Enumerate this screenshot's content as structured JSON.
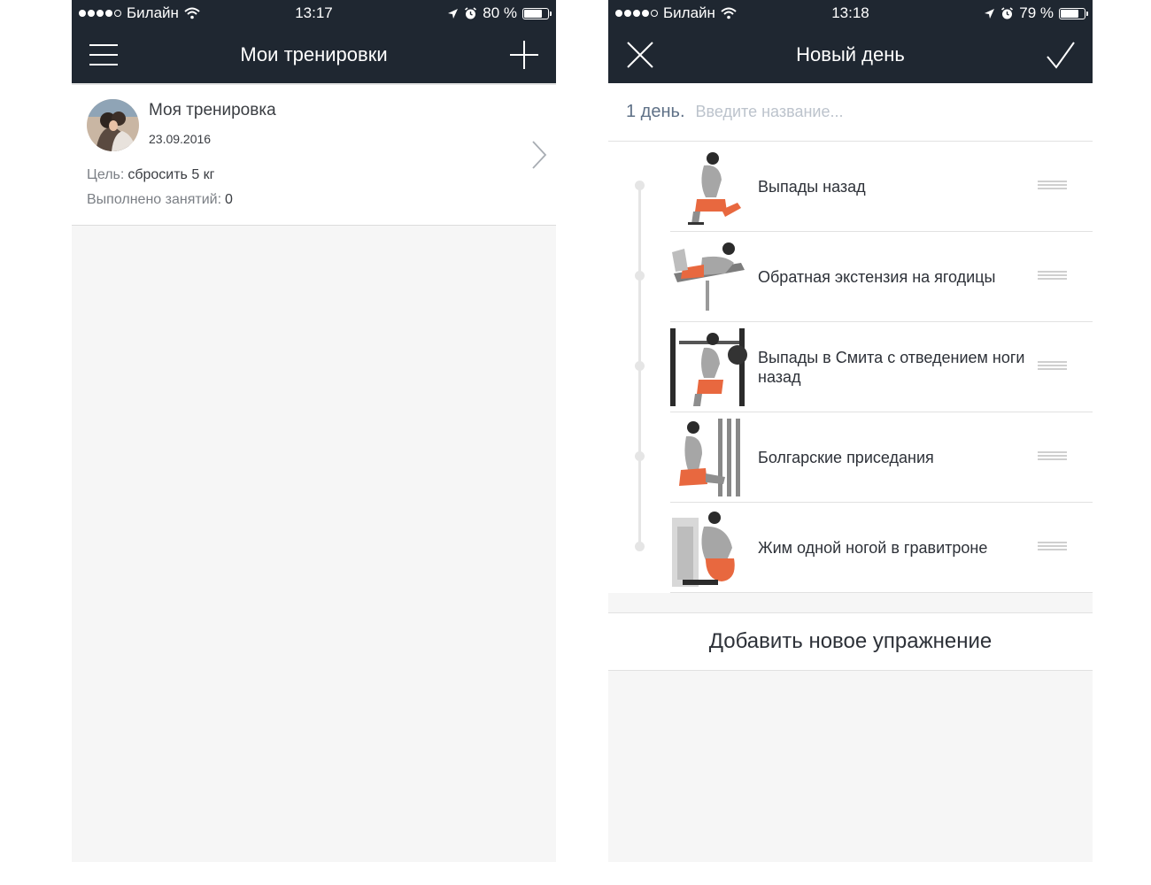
{
  "left": {
    "status": {
      "carrier": "Билайн",
      "time": "13:17",
      "battery": "80 %",
      "battery_level": 0.8
    },
    "nav": {
      "title": "Мои тренировки",
      "left_icon": "menu-icon",
      "right_icon": "plus-icon"
    },
    "workout": {
      "name": "Моя тренировка",
      "date": "23.09.2016",
      "goal_label": "Цель:",
      "goal_value": "сбросить 5 кг",
      "done_label": "Выполнено занятий:",
      "done_value": "0"
    }
  },
  "right": {
    "status": {
      "carrier": "Билайн",
      "time": "13:18",
      "battery": "79 %",
      "battery_level": 0.79
    },
    "nav": {
      "title": "Новый день",
      "left_icon": "close-icon",
      "right_icon": "checkmark-icon"
    },
    "day": {
      "label": "1 день.",
      "name_value": "",
      "name_placeholder": "Введите название..."
    },
    "exercises": [
      {
        "name": "Выпады назад"
      },
      {
        "name": "Обратная экстензия на ягодицы"
      },
      {
        "name": "Выпады в Смита с отведением ноги назад"
      },
      {
        "name": "Болгарские приседания"
      },
      {
        "name": "Жим одной ногой в гравитроне"
      }
    ],
    "add_button": "Добавить новое упражнение"
  },
  "colors": {
    "navbar": "#1f2731",
    "accent_muscle": "#e8683f",
    "background": "#f6f6f6"
  }
}
